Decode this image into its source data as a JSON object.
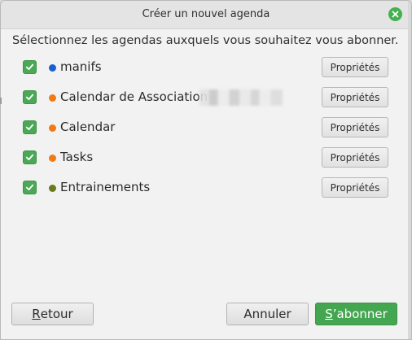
{
  "window": {
    "title": "Créer un nouvel agenda"
  },
  "instruction": "Sélectionnez les agendas auxquels vous souhaitez vous abonner.",
  "calendars": [
    {
      "name": "manifs",
      "color": "#1a5fd0",
      "checked": true,
      "properties_label": "Propriétés"
    },
    {
      "name": "Calendar de Association",
      "color": "#f07a18",
      "checked": true,
      "properties_label": "Propriétés"
    },
    {
      "name": "Calendar",
      "color": "#f07a18",
      "checked": true,
      "properties_label": "Propriétés"
    },
    {
      "name": "Tasks",
      "color": "#f07a18",
      "checked": true,
      "properties_label": "Propriétés"
    },
    {
      "name": "Entrainements",
      "color": "#6b7a1c",
      "checked": true,
      "properties_label": "Propriétés"
    }
  ],
  "footer": {
    "back_label": "Retour",
    "cancel_label": "Annuler",
    "subscribe_label": "S’abonner"
  },
  "icons": {
    "close": "close-icon",
    "check": "check-icon"
  },
  "colors": {
    "accent": "#44a651"
  }
}
